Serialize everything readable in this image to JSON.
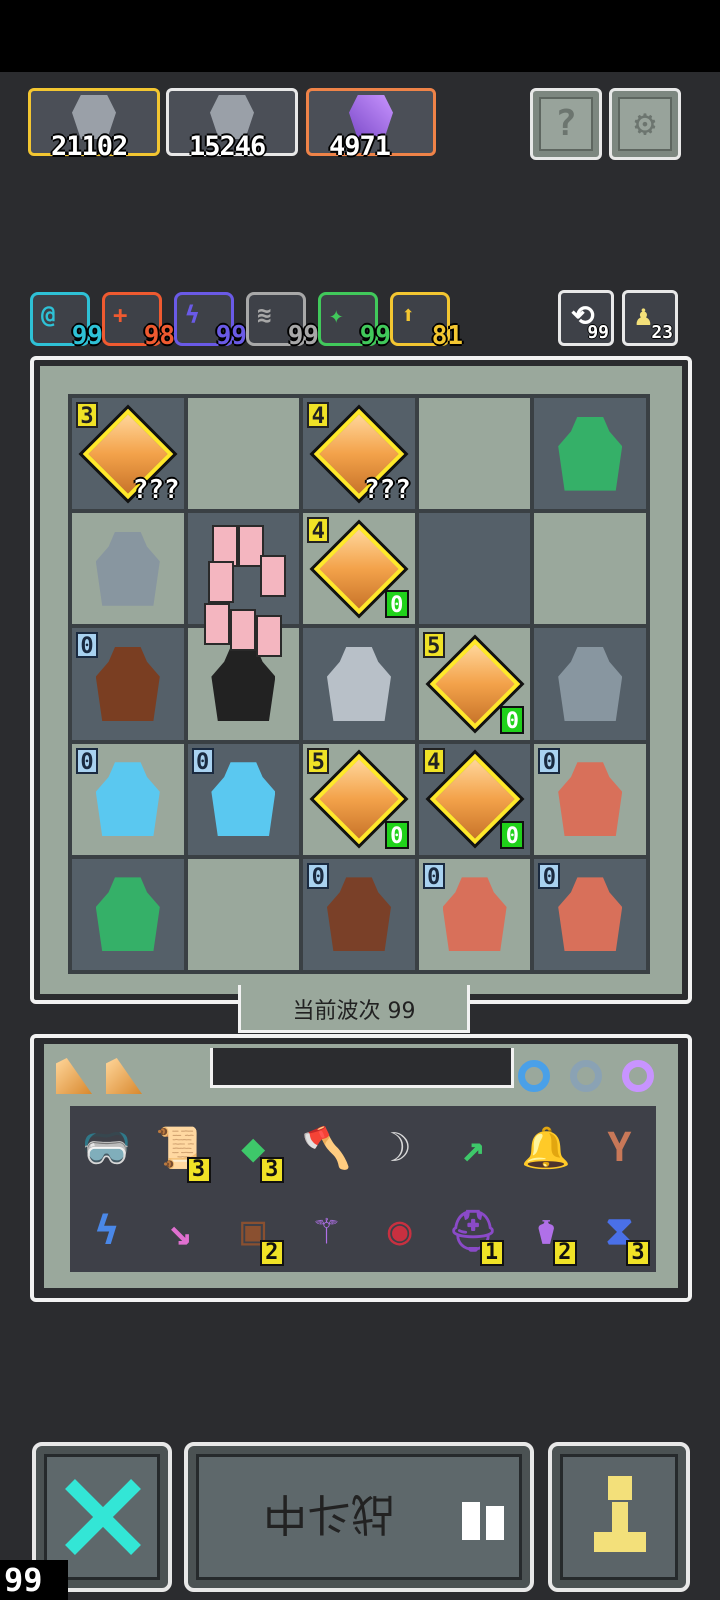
{
  "resources": [
    {
      "icon": "skull-warrior-icon",
      "value": "21102",
      "color": "#f3c631"
    },
    {
      "icon": "ghost-knight-icon",
      "value": "15246",
      "color": "#e8e8e8"
    },
    {
      "icon": "purple-staff-icon",
      "value": "4971",
      "color": "#ef8348"
    }
  ],
  "top_buttons": [
    {
      "icon": "question-icon",
      "glyph": "?"
    },
    {
      "icon": "gear-icon",
      "glyph": "⚙"
    }
  ],
  "buffs": [
    {
      "icon": "cyan-swirl-icon",
      "glyph": "@",
      "value": "99",
      "color": "#2ec1d6"
    },
    {
      "icon": "orange-cross-icon",
      "glyph": "+",
      "value": "98",
      "color": "#ef5a30"
    },
    {
      "icon": "purple-lightning-icon",
      "glyph": "ϟ",
      "value": "99",
      "color": "#6a5ae6"
    },
    {
      "icon": "grey-wings-icon",
      "glyph": "≋",
      "value": "99",
      "color": "#a8a8a8"
    },
    {
      "icon": "green-leaf-icon",
      "glyph": "✦",
      "value": "99",
      "color": "#41c95b"
    },
    {
      "icon": "yellow-arrow-icon",
      "glyph": "⬆",
      "value": "81",
      "color": "#f3c631"
    }
  ],
  "side_buttons": [
    {
      "icon": "refresh-icon",
      "glyph": "⟲",
      "value": "99"
    },
    {
      "icon": "pawn-icon",
      "glyph": "♟",
      "value": "23"
    }
  ],
  "board": [
    [
      {
        "type": "gem",
        "lvl": "3",
        "lvlColor": "yellow",
        "label": "???"
      },
      {
        "type": "empty"
      },
      {
        "type": "gem",
        "lvl": "4",
        "lvlColor": "yellow",
        "label": "???"
      },
      {
        "type": "empty"
      },
      {
        "type": "monster",
        "name": "green-dragon",
        "glyph": "🐊"
      }
    ],
    [
      {
        "type": "monster",
        "name": "stone-golem",
        "glyph": "🗿"
      },
      {
        "type": "empty"
      },
      {
        "type": "gem",
        "lvl": "4",
        "lvlColor": "yellow",
        "count": "0"
      },
      {
        "type": "empty"
      },
      {
        "type": "empty"
      }
    ],
    [
      {
        "type": "monster",
        "name": "chained-chest",
        "glyph": "⛓",
        "lvl": "0",
        "lvlColor": "blue"
      },
      {
        "type": "monster",
        "name": "hero-fighting",
        "glyph": "⚔"
      },
      {
        "type": "monster",
        "name": "armored-knight",
        "glyph": "🛡"
      },
      {
        "type": "gem",
        "lvl": "5",
        "lvlColor": "yellow",
        "count": "0"
      },
      {
        "type": "monster",
        "name": "stone-golem",
        "glyph": "🗿"
      }
    ],
    [
      {
        "type": "monster",
        "name": "ice-demon",
        "glyph": "👹",
        "lvl": "0",
        "lvlColor": "blue"
      },
      {
        "type": "monster",
        "name": "ice-demon",
        "glyph": "👹",
        "lvl": "0",
        "lvlColor": "blue"
      },
      {
        "type": "gem",
        "lvl": "5",
        "lvlColor": "yellow",
        "count": "0"
      },
      {
        "type": "gem",
        "lvl": "4",
        "lvlColor": "yellow",
        "count": "0"
      },
      {
        "type": "monster",
        "name": "red-orc-axe",
        "glyph": "👺",
        "lvl": "0",
        "lvlColor": "blue"
      }
    ],
    [
      {
        "type": "monster",
        "name": "green-dragon",
        "glyph": "🐊"
      },
      {
        "type": "empty"
      },
      {
        "type": "monster",
        "name": "minotaur",
        "glyph": "🐂",
        "lvl": "0",
        "lvlColor": "blue"
      },
      {
        "type": "monster",
        "name": "red-orc-axe",
        "glyph": "👺",
        "lvl": "0",
        "lvlColor": "blue"
      },
      {
        "type": "monster",
        "name": "red-orc-axe",
        "glyph": "👺",
        "lvl": "0",
        "lvlColor": "blue"
      }
    ]
  ],
  "wave_label": "当前波次 99",
  "inventory_tabs": [
    {
      "icon": "gold-shard-icon"
    },
    {
      "icon": "gold-shard-icon"
    }
  ],
  "inventory_rings": [
    {
      "icon": "blue-ring-icon",
      "color": "#4aa0e8"
    },
    {
      "icon": "grey-armor-icon",
      "color": "#8aa2b4"
    },
    {
      "icon": "gold-ring-icon",
      "color": "#c894ff"
    }
  ],
  "inventory": [
    {
      "icon": "blue-goggles-icon",
      "glyph": "🥽",
      "color": "#4a88e8"
    },
    {
      "icon": "scroll-icon",
      "glyph": "📜",
      "color": "#d8d8d8",
      "count": "3"
    },
    {
      "icon": "green-gem-icon",
      "glyph": "◆",
      "color": "#3ec86a",
      "count": "3"
    },
    {
      "icon": "orange-axe-icon",
      "glyph": "🪓",
      "color": "#f08a30"
    },
    {
      "icon": "scythe-icon",
      "glyph": "☽",
      "color": "#d8d8d8"
    },
    {
      "icon": "green-arrow-icon",
      "glyph": "↗",
      "color": "#3ec86a"
    },
    {
      "icon": "bell-icon",
      "glyph": "🔔",
      "color": "#3c6a78"
    },
    {
      "icon": "slingshot-icon",
      "glyph": "Y",
      "color": "#c87858"
    },
    {
      "icon": "blue-wind-icon",
      "glyph": "ϟ",
      "color": "#4a88e8"
    },
    {
      "icon": "pink-arrow-icon",
      "glyph": "↘",
      "color": "#e070d0"
    },
    {
      "icon": "wood-shield-icon",
      "glyph": "▣",
      "color": "#8a5030",
      "count": "2"
    },
    {
      "icon": "purple-staff-icon",
      "glyph": "⚚",
      "color": "#b070e8"
    },
    {
      "icon": "red-eye-icon",
      "glyph": "◉",
      "color": "#c83040"
    },
    {
      "icon": "purple-helmet-icon",
      "glyph": "⛑",
      "color": "#8a4ac8",
      "count": "1"
    },
    {
      "icon": "potion-jar-icon",
      "glyph": "⚱",
      "color": "#b070e8",
      "count": "2"
    },
    {
      "icon": "hourglass-icon",
      "glyph": "⧗",
      "color": "#4a70e8",
      "count": "3"
    }
  ],
  "bottom": {
    "left_icon": "crossed-swords-icon",
    "battle_label": "战斗中",
    "battle_icon": "book-icon",
    "right_icon": "pawn-icon",
    "corner_number": "99"
  }
}
